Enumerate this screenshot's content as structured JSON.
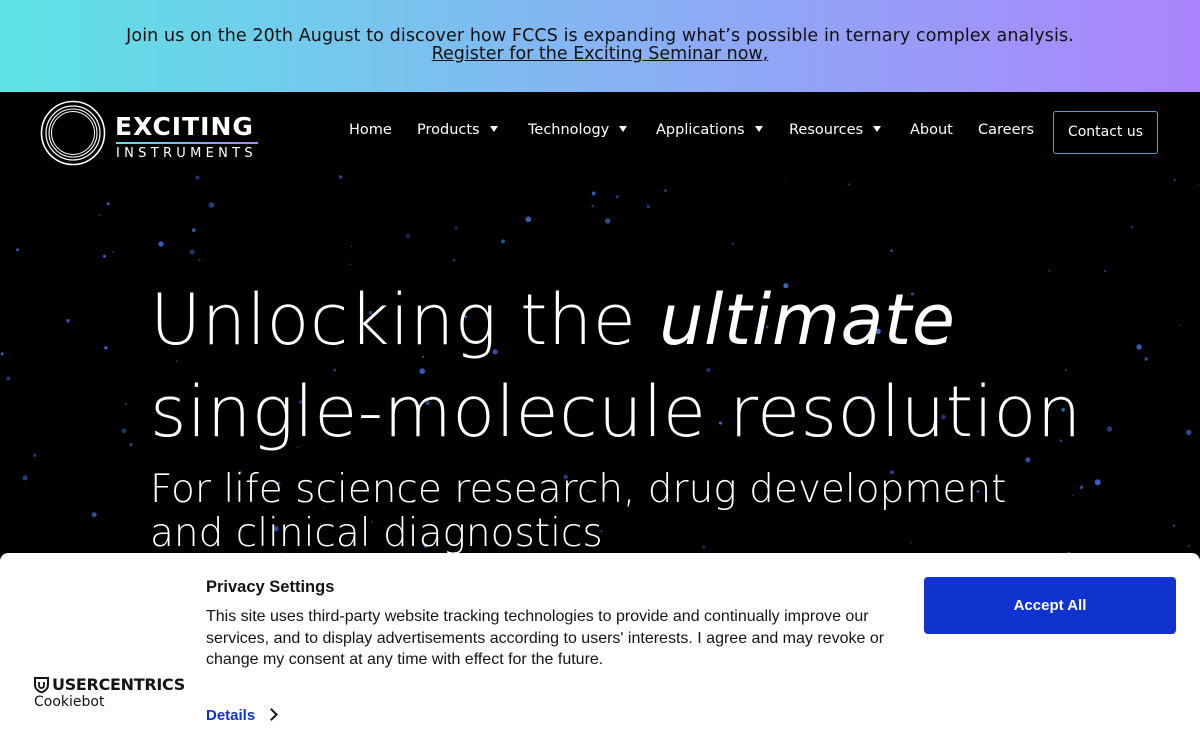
{
  "announcement": {
    "text": "Join us on the 20th August to discover how FCCS is expanding what’s possible in ternary complex analysis.",
    "link": "Register for the Exciting Seminar now,"
  },
  "header": {
    "logo": {
      "word": "EXCITING",
      "sub": "INSTRUMENTS"
    },
    "nav": [
      {
        "label": "Home",
        "dropdown": false
      },
      {
        "label": "Products",
        "dropdown": true
      },
      {
        "label": "Technology",
        "dropdown": true
      },
      {
        "label": "Applications",
        "dropdown": true
      },
      {
        "label": "Resources",
        "dropdown": true
      },
      {
        "label": "About",
        "dropdown": false
      },
      {
        "label": "Careers",
        "dropdown": false
      }
    ],
    "contact_label": "Contact us"
  },
  "hero": {
    "headline_start": "Unlocking the ",
    "headline_em": "ultimate",
    "headline_line2": "single-molecule resolution",
    "subhead_line1": "For life science research, drug development",
    "subhead_line2": "and clinical diagnostics"
  },
  "cookie_banner": {
    "brand": "USERCENTRICS",
    "brand_sub": "Cookiebot",
    "title": "Privacy Settings",
    "text": "This site uses third-party website tracking technologies to provide and continually improve our services, and to display advertisements according to users' interests. I agree and may revoke or change my consent at any time with effect for the future.",
    "details_label": "Details",
    "accept_label": "Accept All"
  },
  "colors": {
    "accent_blue": "#1032cf",
    "contact_border": "#4aa6d6",
    "gradient_start": "#5ee3e4",
    "gradient_end": "#ab84fd"
  },
  "icons": [
    "logo-rings-icon",
    "caret-down-icon",
    "usercentrics-shield-icon",
    "chevron-right-icon"
  ]
}
